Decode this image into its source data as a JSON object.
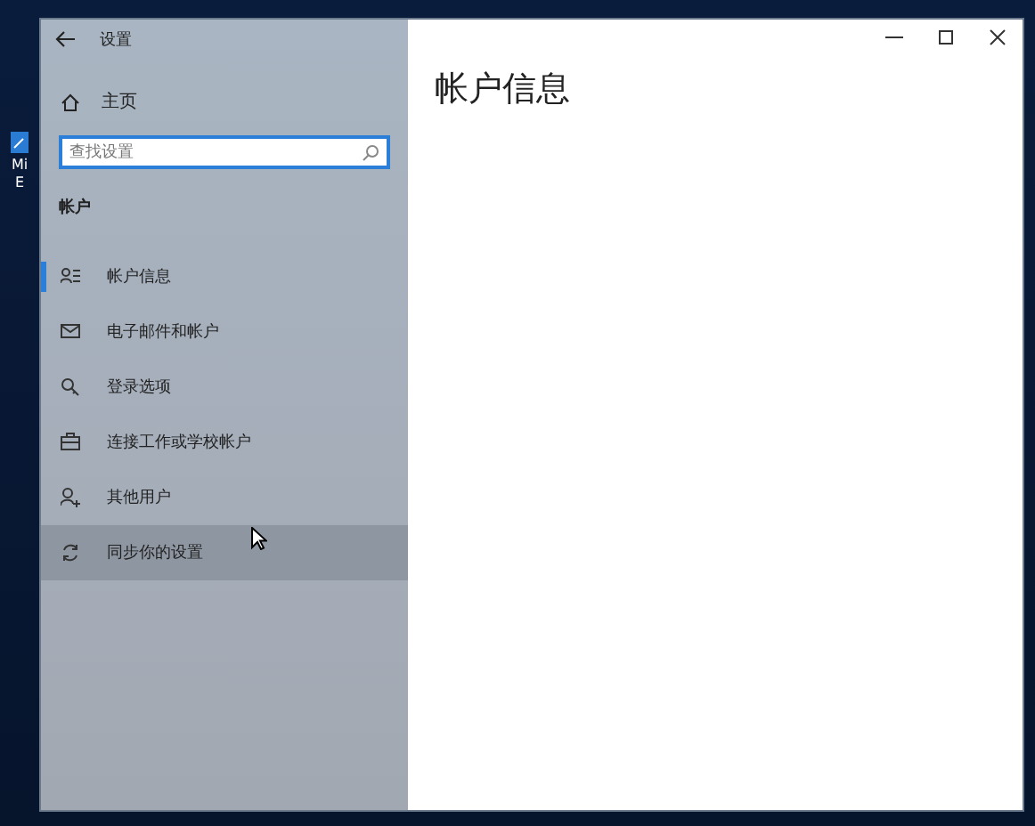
{
  "desktop": {
    "icons": [
      {
        "label": "Mi\nE"
      }
    ]
  },
  "window": {
    "title": "设置"
  },
  "sidebar": {
    "home": "主页",
    "search": {
      "placeholder": "查找设置"
    },
    "section": "帐户",
    "items": [
      {
        "label": "帐户信息",
        "selected": true,
        "hovered": false
      },
      {
        "label": "电子邮件和帐户",
        "selected": false,
        "hovered": false
      },
      {
        "label": "登录选项",
        "selected": false,
        "hovered": false
      },
      {
        "label": "连接工作或学校帐户",
        "selected": false,
        "hovered": false
      },
      {
        "label": "其他用户",
        "selected": false,
        "hovered": false
      },
      {
        "label": "同步你的设置",
        "selected": false,
        "hovered": true
      }
    ]
  },
  "content": {
    "heading": "帐户信息"
  }
}
